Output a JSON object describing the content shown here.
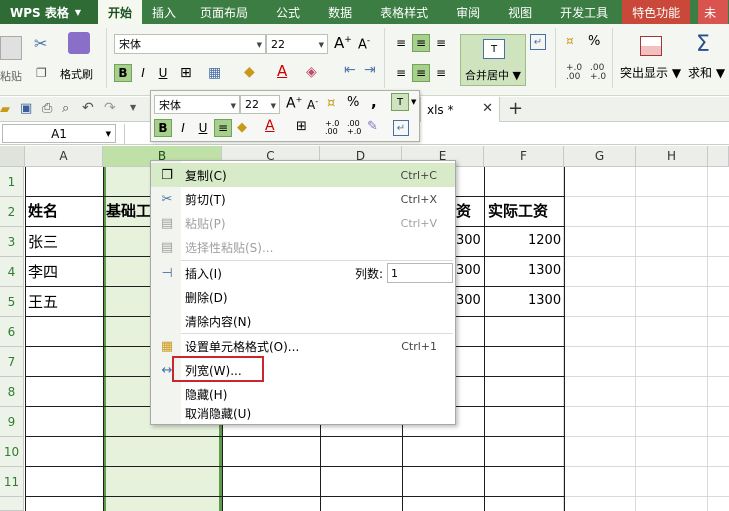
{
  "app": {
    "name": "WPS 表格"
  },
  "menu_tabs": [
    "开始",
    "插入",
    "页面布局",
    "公式",
    "数据",
    "表格样式",
    "审阅",
    "视图",
    "开发工具",
    "特色功能",
    "未"
  ],
  "ribbon": {
    "paste_label": "粘贴",
    "copy_label": "复制",
    "format_painter_label": "格式刷",
    "font_name": "宋体",
    "font_size": "22",
    "merge_center_label": "合并居中",
    "conditional_display_label": "突出显示",
    "sum_label": "求和",
    "percent_symbol": "%",
    "bold": "B",
    "italic": "I",
    "underline": "U"
  },
  "file_tab": {
    "label": "xls *"
  },
  "namebox": {
    "value": "A1"
  },
  "mini_toolbar": {
    "font_name": "宋体",
    "font_size": "22"
  },
  "columns": [
    "A",
    "B",
    "C",
    "D",
    "E",
    "F",
    "G",
    "H"
  ],
  "rows": [
    "1",
    "2",
    "3",
    "4",
    "5",
    "6",
    "7",
    "8",
    "9",
    "10",
    "11"
  ],
  "cells": {
    "A2": "姓名",
    "B2": "基础工",
    "E2": "资",
    "F2": "实际工资",
    "A3": "张三",
    "E3": "300",
    "F3": "1200",
    "A4": "李四",
    "E4": "300",
    "F4": "1300",
    "A5": "王五",
    "E5": "300",
    "F5": "1300"
  },
  "context_menu": {
    "items": [
      {
        "label": "复制(C)",
        "shortcut": "Ctrl+C"
      },
      {
        "label": "剪切(T)",
        "shortcut": "Ctrl+X"
      },
      {
        "label": "粘贴(P)",
        "shortcut": "Ctrl+V"
      },
      {
        "label": "选择性粘贴(S)..."
      },
      {
        "label": "插入(I)",
        "extra_label": "列数:",
        "extra_value": "1"
      },
      {
        "label": "删除(D)"
      },
      {
        "label": "清除内容(N)"
      },
      {
        "label": "设置单元格格式(O)...",
        "shortcut": "Ctrl+1"
      },
      {
        "label": "列宽(W)..."
      },
      {
        "label": "隐藏(H)"
      },
      {
        "label": "取消隐藏(U)"
      }
    ]
  },
  "colors": {
    "accent": "#3c7d43",
    "highlight_box": "#c8282d",
    "selected_column": "#e6f2dc"
  }
}
